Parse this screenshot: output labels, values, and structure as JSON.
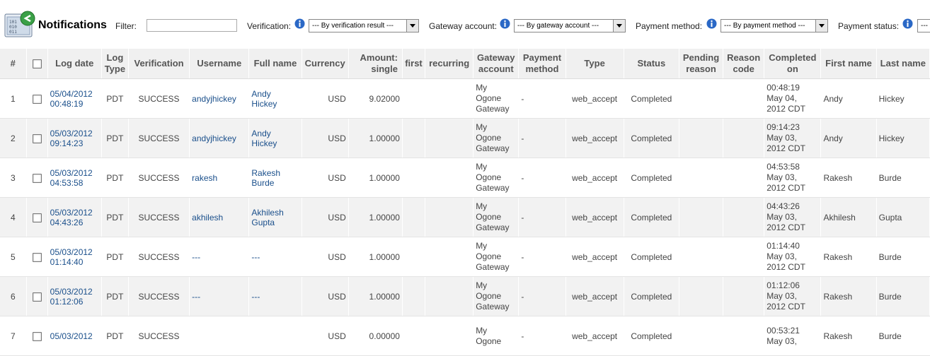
{
  "header": {
    "title": "Notifications",
    "filter_label": "Filter:",
    "filter_value": "",
    "verification_label": "Verification:",
    "verification_select": "--- By verification result ---",
    "gateway_label": "Gateway account:",
    "gateway_select": "--- By gateway account ---",
    "payment_method_label": "Payment method:",
    "payment_method_select": "--- By payment method ---",
    "payment_status_label": "Payment status:",
    "payment_status_select": "---"
  },
  "columns": [
    "#",
    "",
    "Log date",
    "Log Type",
    "Verification",
    "Username",
    "Full name",
    "Currency",
    "Amount: single",
    "first",
    "recurring",
    "Gateway account",
    "Payment method",
    "Type",
    "Status",
    "Pending reason",
    "Reason code",
    "Completed on",
    "First name",
    "Last name"
  ],
  "rows": [
    {
      "num": "1",
      "date1": "05/04/2012",
      "date2": "00:48:19",
      "logtype": "PDT",
      "verification": "SUCCESS",
      "username": "andyjhickey",
      "full1": "Andy",
      "full2": "Hickey",
      "currency": "USD",
      "amount": "9.02000",
      "first": "",
      "recurring": "",
      "gw1": "My",
      "gw2": "Ogone",
      "gw3": "Gateway",
      "method": "-",
      "type": "web_accept",
      "status": "Completed",
      "pending": "",
      "reason": "",
      "co1": "00:48:19",
      "co2": "May 04,",
      "co3": "2012 CDT",
      "firstname": "Andy",
      "lastname": "Hickey"
    },
    {
      "num": "2",
      "date1": "05/03/2012",
      "date2": "09:14:23",
      "logtype": "PDT",
      "verification": "SUCCESS",
      "username": "andyjhickey",
      "full1": "Andy",
      "full2": "Hickey",
      "currency": "USD",
      "amount": "1.00000",
      "first": "",
      "recurring": "",
      "gw1": "My",
      "gw2": "Ogone",
      "gw3": "Gateway",
      "method": "-",
      "type": "web_accept",
      "status": "Completed",
      "pending": "",
      "reason": "",
      "co1": "09:14:23",
      "co2": "May 03,",
      "co3": "2012 CDT",
      "firstname": "Andy",
      "lastname": "Hickey"
    },
    {
      "num": "3",
      "date1": "05/03/2012",
      "date2": "04:53:58",
      "logtype": "PDT",
      "verification": "SUCCESS",
      "username": "rakesh",
      "full1": "Rakesh",
      "full2": "Burde",
      "currency": "USD",
      "amount": "1.00000",
      "first": "",
      "recurring": "",
      "gw1": "My",
      "gw2": "Ogone",
      "gw3": "Gateway",
      "method": "-",
      "type": "web_accept",
      "status": "Completed",
      "pending": "",
      "reason": "",
      "co1": "04:53:58",
      "co2": "May 03,",
      "co3": "2012 CDT",
      "firstname": "Rakesh",
      "lastname": "Burde"
    },
    {
      "num": "4",
      "date1": "05/03/2012",
      "date2": "04:43:26",
      "logtype": "PDT",
      "verification": "SUCCESS",
      "username": "akhilesh",
      "full1": "Akhilesh",
      "full2": "Gupta",
      "currency": "USD",
      "amount": "1.00000",
      "first": "",
      "recurring": "",
      "gw1": "My",
      "gw2": "Ogone",
      "gw3": "Gateway",
      "method": "-",
      "type": "web_accept",
      "status": "Completed",
      "pending": "",
      "reason": "",
      "co1": "04:43:26",
      "co2": "May 03,",
      "co3": "2012 CDT",
      "firstname": "Akhilesh",
      "lastname": "Gupta"
    },
    {
      "num": "5",
      "date1": "05/03/2012",
      "date2": "01:14:40",
      "logtype": "PDT",
      "verification": "SUCCESS",
      "username": "---",
      "full1": "---",
      "full2": "",
      "currency": "USD",
      "amount": "1.00000",
      "first": "",
      "recurring": "",
      "gw1": "My",
      "gw2": "Ogone",
      "gw3": "Gateway",
      "method": "-",
      "type": "web_accept",
      "status": "Completed",
      "pending": "",
      "reason": "",
      "co1": "01:14:40",
      "co2": "May 03,",
      "co3": "2012 CDT",
      "firstname": "Rakesh",
      "lastname": "Burde"
    },
    {
      "num": "6",
      "date1": "05/03/2012",
      "date2": "01:12:06",
      "logtype": "PDT",
      "verification": "SUCCESS",
      "username": "---",
      "full1": "---",
      "full2": "",
      "currency": "USD",
      "amount": "1.00000",
      "first": "",
      "recurring": "",
      "gw1": "My",
      "gw2": "Ogone",
      "gw3": "Gateway",
      "method": "-",
      "type": "web_accept",
      "status": "Completed",
      "pending": "",
      "reason": "",
      "co1": "01:12:06",
      "co2": "May 03,",
      "co3": "2012 CDT",
      "firstname": "Rakesh",
      "lastname": "Burde"
    },
    {
      "num": "7",
      "date1": "05/03/2012",
      "date2": "",
      "logtype": "PDT",
      "verification": "SUCCESS",
      "username": "",
      "full1": "",
      "full2": "",
      "currency": "USD",
      "amount": "0.00000",
      "first": "",
      "recurring": "",
      "gw1": "My",
      "gw2": "Ogone",
      "gw3": "",
      "method": "-",
      "type": "web_accept",
      "status": "Completed",
      "pending": "",
      "reason": "",
      "co1": "00:53:21",
      "co2": "May 03,",
      "co3": "",
      "firstname": "Rakesh",
      "lastname": "Burde"
    }
  ]
}
